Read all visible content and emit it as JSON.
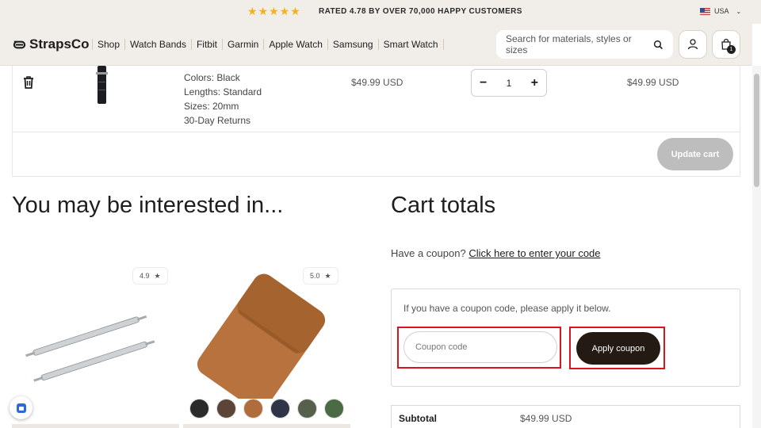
{
  "topbar": {
    "stars": "★★★★★",
    "rating_text": "RATED 4.78 BY OVER 70,000 HAPPY CUSTOMERS",
    "locale": "USA"
  },
  "header": {
    "brand": "StrapsCo",
    "nav": [
      "Shop",
      "Watch Bands",
      "Fitbit",
      "Garmin",
      "Apple Watch",
      "Samsung",
      "Smart Watch"
    ],
    "search_placeholder": "Search for materials, styles or sizes",
    "cart_count": "1"
  },
  "cart_item": {
    "details": [
      "Colors: Black",
      "Lengths: Standard",
      "Sizes: 20mm",
      "30-Day Returns"
    ],
    "price": "$49.99 USD",
    "quantity": "1",
    "line_total": "$49.99 USD"
  },
  "cart_actions": {
    "update_label": "Update cart"
  },
  "recommendations": {
    "title": "You may be interested in...",
    "products": [
      {
        "rating": "4.9"
      },
      {
        "rating": "5.0",
        "swatch_colors": [
          "#2b2b2b",
          "#5a4536",
          "#b06c3b",
          "#2f3547",
          "#56604c",
          "#4a6b43"
        ]
      }
    ]
  },
  "totals": {
    "title": "Cart totals",
    "coupon_question": "Have a coupon?",
    "coupon_link": "Click here to enter your code",
    "coupon_hint": "If you have a coupon code, please apply it below.",
    "coupon_placeholder": "Coupon code",
    "apply_label": "Apply coupon",
    "subtotal_label": "Subtotal",
    "subtotal_value": "$49.99 USD"
  },
  "colors": {
    "accent_dark": "#231a14",
    "highlight": "#d8141c",
    "header_bg": "#f1eee9"
  }
}
